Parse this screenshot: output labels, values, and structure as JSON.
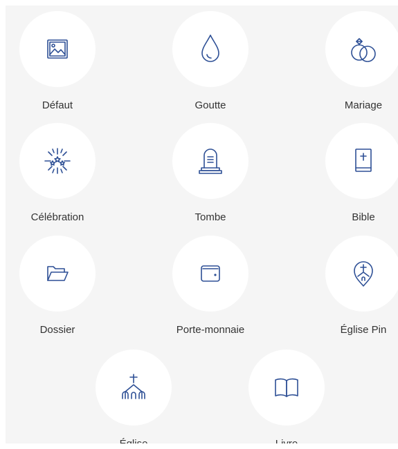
{
  "theme": {
    "icon_color": "#2d4f95",
    "panel_bg": "#f5f5f5",
    "circle_bg": "#ffffff",
    "label_color": "#333333"
  },
  "icons": [
    {
      "label": "Défaut",
      "icon": "image-icon"
    },
    {
      "label": "Goutte",
      "icon": "drop-icon"
    },
    {
      "label": "Mariage",
      "icon": "wedding-rings-icon"
    },
    {
      "label": "Célébration",
      "icon": "fireworks-icon"
    },
    {
      "label": "Tombe",
      "icon": "tombstone-icon"
    },
    {
      "label": "Bible",
      "icon": "bible-icon"
    },
    {
      "label": "Dossier",
      "icon": "folder-icon"
    },
    {
      "label": "Porte-monnaie",
      "icon": "wallet-icon"
    },
    {
      "label": "Église Pin",
      "icon": "church-pin-icon"
    },
    {
      "label": "Église",
      "icon": "church-icon"
    },
    {
      "label": "Livre",
      "icon": "book-icon"
    }
  ]
}
